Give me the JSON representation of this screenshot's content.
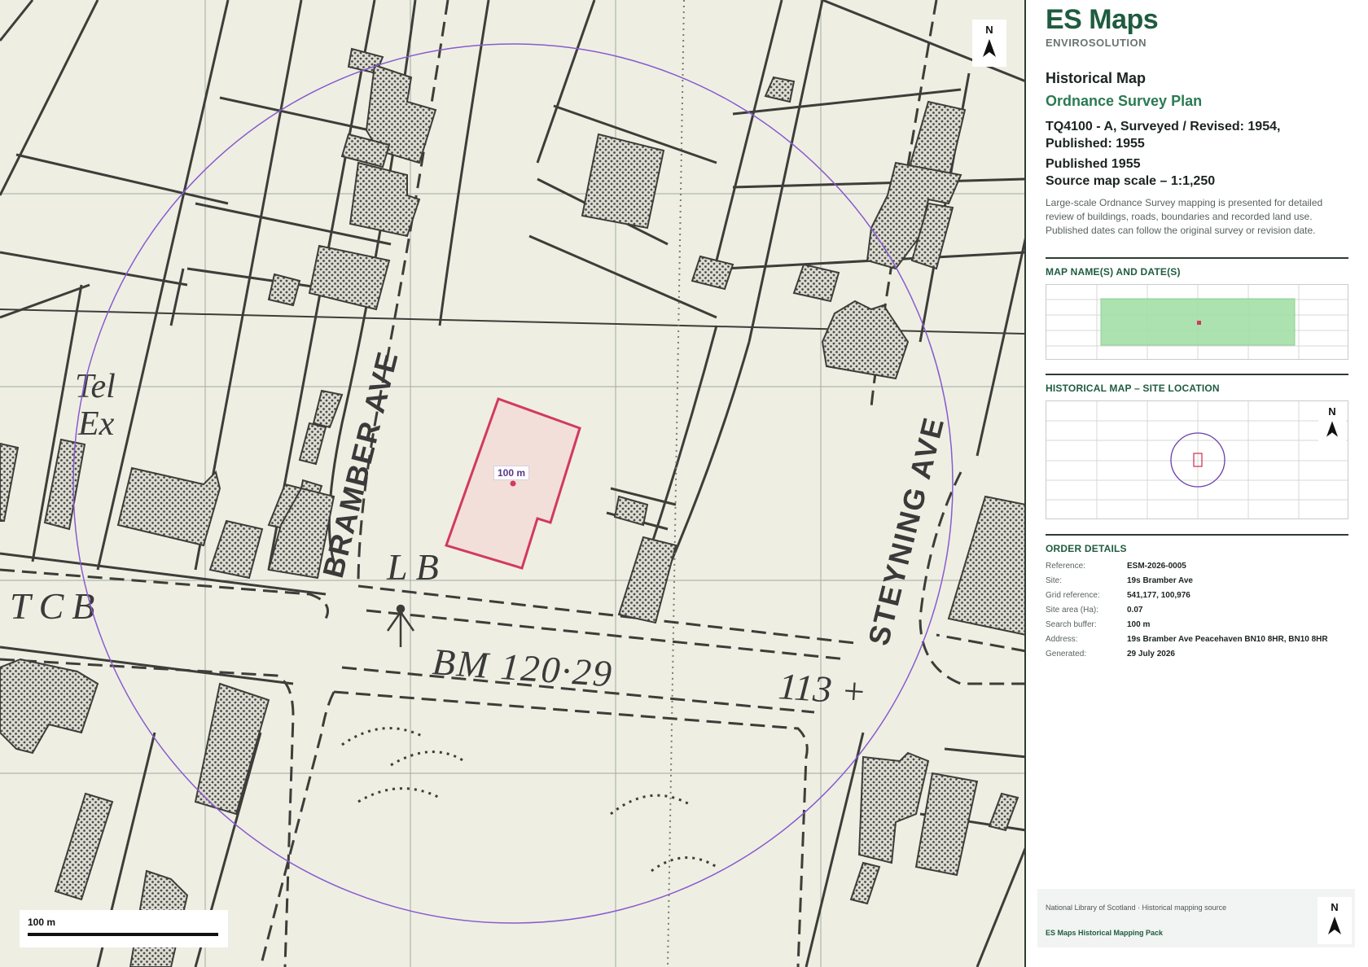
{
  "map": {
    "north_label": "N",
    "scale_label": "100 m",
    "buffer_label": "100 m",
    "labels": {
      "tel": "Tel",
      "ex": "Ex",
      "tcb": "TCB",
      "lb": "LB",
      "bm": "BM 120·29",
      "spot_height": "113 +",
      "bramber_ave": "BRAMBER AVE",
      "steyning_ave": "STEYNING AVE"
    },
    "colors": {
      "paper": "#eeefe2",
      "ink": "#3a3a3a",
      "building_fill": "#c9c9c0",
      "site_outline": "#d23a5c",
      "site_fill": "#f1dcd8",
      "buffer_circle": "#8a5ad0",
      "grid": "#9ba39b"
    }
  },
  "sidebar": {
    "brand_title": "ES Maps",
    "brand_subtitle": "ENVIROSOLUTION",
    "map_type": "Historical Map",
    "map_series": "Ordnance Survey Plan",
    "sheet_info": "TQ4100 - A, Surveyed / Revised: 1954, Published: 1955",
    "published": "Published 1955",
    "source_scale": "Source map scale – 1:1,250",
    "description": "Large-scale Ordnance Survey mapping is presented for detailed review of buildings, roads, boundaries and recorded land use. Published dates can follow the original survey or revision date.",
    "section_map_names": "MAP NAME(S) AND DATE(S)",
    "section_site_location": "HISTORICAL MAP – SITE LOCATION",
    "section_order_details": "ORDER DETAILS",
    "location_north_label": "N",
    "colors": {
      "brand": "#1f5c3f",
      "accent": "#2b7a52",
      "coverage_fill": "#a3dfa6",
      "site_marker": "#d23a5c",
      "buffer": "#6a3ea8"
    }
  },
  "order_details": [
    {
      "key": "Reference:",
      "value": "ESM-2026-0005"
    },
    {
      "key": "Site:",
      "value": "19s Bramber Ave"
    },
    {
      "key": "Grid reference:",
      "value": "541,177, 100,976"
    },
    {
      "key": "Site area (Ha):",
      "value": "0.07"
    },
    {
      "key": "Search buffer:",
      "value": "100 m"
    },
    {
      "key": "Address:",
      "value": "19s Bramber Ave Peacehaven BN10 8HR, BN10 8HR"
    },
    {
      "key": "Generated:",
      "value": "29 July 2026"
    }
  ],
  "footer": {
    "source": "National Library of Scotland · Historical mapping source",
    "pack": "ES Maps Historical Mapping Pack",
    "north_label": "N"
  }
}
